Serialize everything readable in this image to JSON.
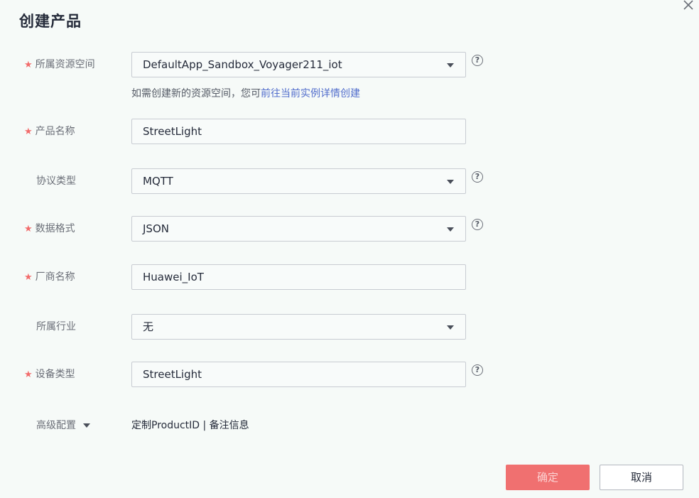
{
  "dialog": {
    "title": "创建产品",
    "close_icon": "close-icon"
  },
  "form": {
    "resource_space": {
      "label": "所属资源空间",
      "required": true,
      "value": "DefaultApp_Sandbox_Voyager211_iot",
      "type": "select",
      "help": "?"
    },
    "hint": {
      "text": "如需创建新的资源空间，您可",
      "link": "前往当前实例详情创建"
    },
    "product_name": {
      "label": "产品名称",
      "required": true,
      "value": "StreetLight",
      "type": "input"
    },
    "protocol": {
      "label": "协议类型",
      "required": false,
      "value": "MQTT",
      "type": "select",
      "help": "?"
    },
    "data_format": {
      "label": "数据格式",
      "required": true,
      "value": "JSON",
      "type": "select",
      "help": "?"
    },
    "manufacturer": {
      "label": "厂商名称",
      "required": true,
      "value": "Huawei_IoT",
      "type": "input"
    },
    "industry": {
      "label": "所属行业",
      "required": false,
      "value": "无",
      "type": "select"
    },
    "device_type": {
      "label": "设备类型",
      "required": true,
      "value": "StreetLight",
      "type": "input",
      "help": "?"
    },
    "advanced": {
      "label": "高级配置",
      "summary": "定制ProductID | 备注信息"
    }
  },
  "buttons": {
    "confirm": "确定",
    "cancel": "取消"
  },
  "colors": {
    "required_star": "#f26b6b",
    "link": "#526ecc",
    "confirm_bg": "#f07070"
  }
}
